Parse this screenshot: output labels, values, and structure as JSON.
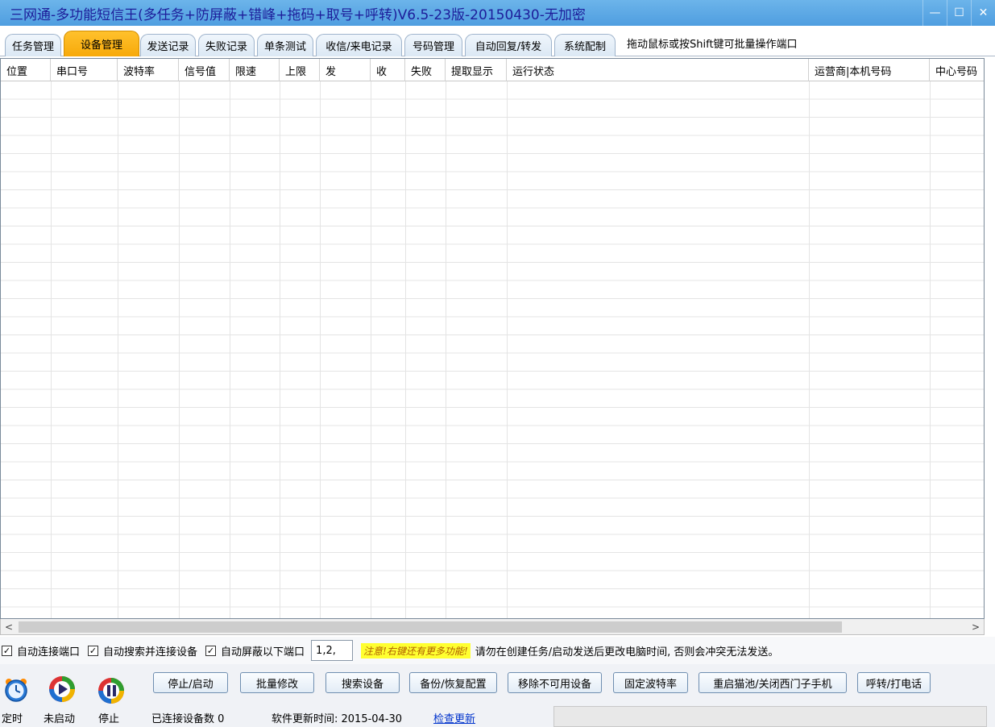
{
  "window": {
    "title": "三网通-多功能短信王(多任务+防屏蔽+错峰+拖码+取号+呼转)V6.5-23版-20150430-无加密",
    "controls": [
      "—",
      "☐",
      "✕"
    ]
  },
  "tabs": [
    {
      "label": "任务管理",
      "active": false
    },
    {
      "label": "设备管理",
      "active": true
    },
    {
      "label": "发送记录",
      "active": false
    },
    {
      "label": "失败记录",
      "active": false
    },
    {
      "label": "单条测试",
      "active": false
    },
    {
      "label": "收信/来电记录",
      "active": false
    },
    {
      "label": "号码管理",
      "active": false
    },
    {
      "label": "自动回复/转发",
      "active": false
    },
    {
      "label": "系统配制",
      "active": false
    }
  ],
  "tab_hint": "拖动鼠标或按Shift键可批量操作端口",
  "table": {
    "columns": [
      "位置",
      "串口号",
      "波特率",
      "信号值",
      "限速",
      "上限",
      "发",
      "收",
      "失败",
      "提取显示",
      "运行状态",
      "运营商|本机号码",
      "中心号码"
    ],
    "rows": []
  },
  "scrollbar": {
    "left_arrow": "<",
    "right_arrow": ">"
  },
  "options": {
    "auto_connect": {
      "label": "自动连接端口",
      "checked": true
    },
    "auto_search": {
      "label": "自动搜索并连接设备",
      "checked": true
    },
    "auto_block": {
      "label": "自动屏蔽以下端口",
      "checked": true
    },
    "blocked_ports": "1,2,",
    "notice": "注意!右键还有更多功能!",
    "warning": "请勿在创建任务/启动发送后更改电脑时间, 否则会冲突无法发送。"
  },
  "controls": {
    "timer": {
      "label": "定时",
      "icon": "alarm-clock-icon"
    },
    "start": {
      "label": "未启动",
      "icon": "play-icon"
    },
    "stop": {
      "label": "停止",
      "icon": "pause-icon"
    }
  },
  "buttons": {
    "stop_start": "停止/启动",
    "batch_modify": "批量修改",
    "search_device": "搜索设备",
    "backup_restore": "备份/恢复配置",
    "remove_unusable": "移除不可用设备",
    "fix_baud": "固定波特率",
    "restart_pool": "重启猫池/关闭西门子手机",
    "call_forward": "呼转/打电话"
  },
  "status": {
    "connected_devices": "已连接设备数 0",
    "update_time": "软件更新时间: 2015-04-30",
    "check_update": "检查更新"
  },
  "colors": {
    "title_bg": "#5aa6e4",
    "active_tab": "#fbb41a",
    "button_border": "#6f8eb0"
  }
}
